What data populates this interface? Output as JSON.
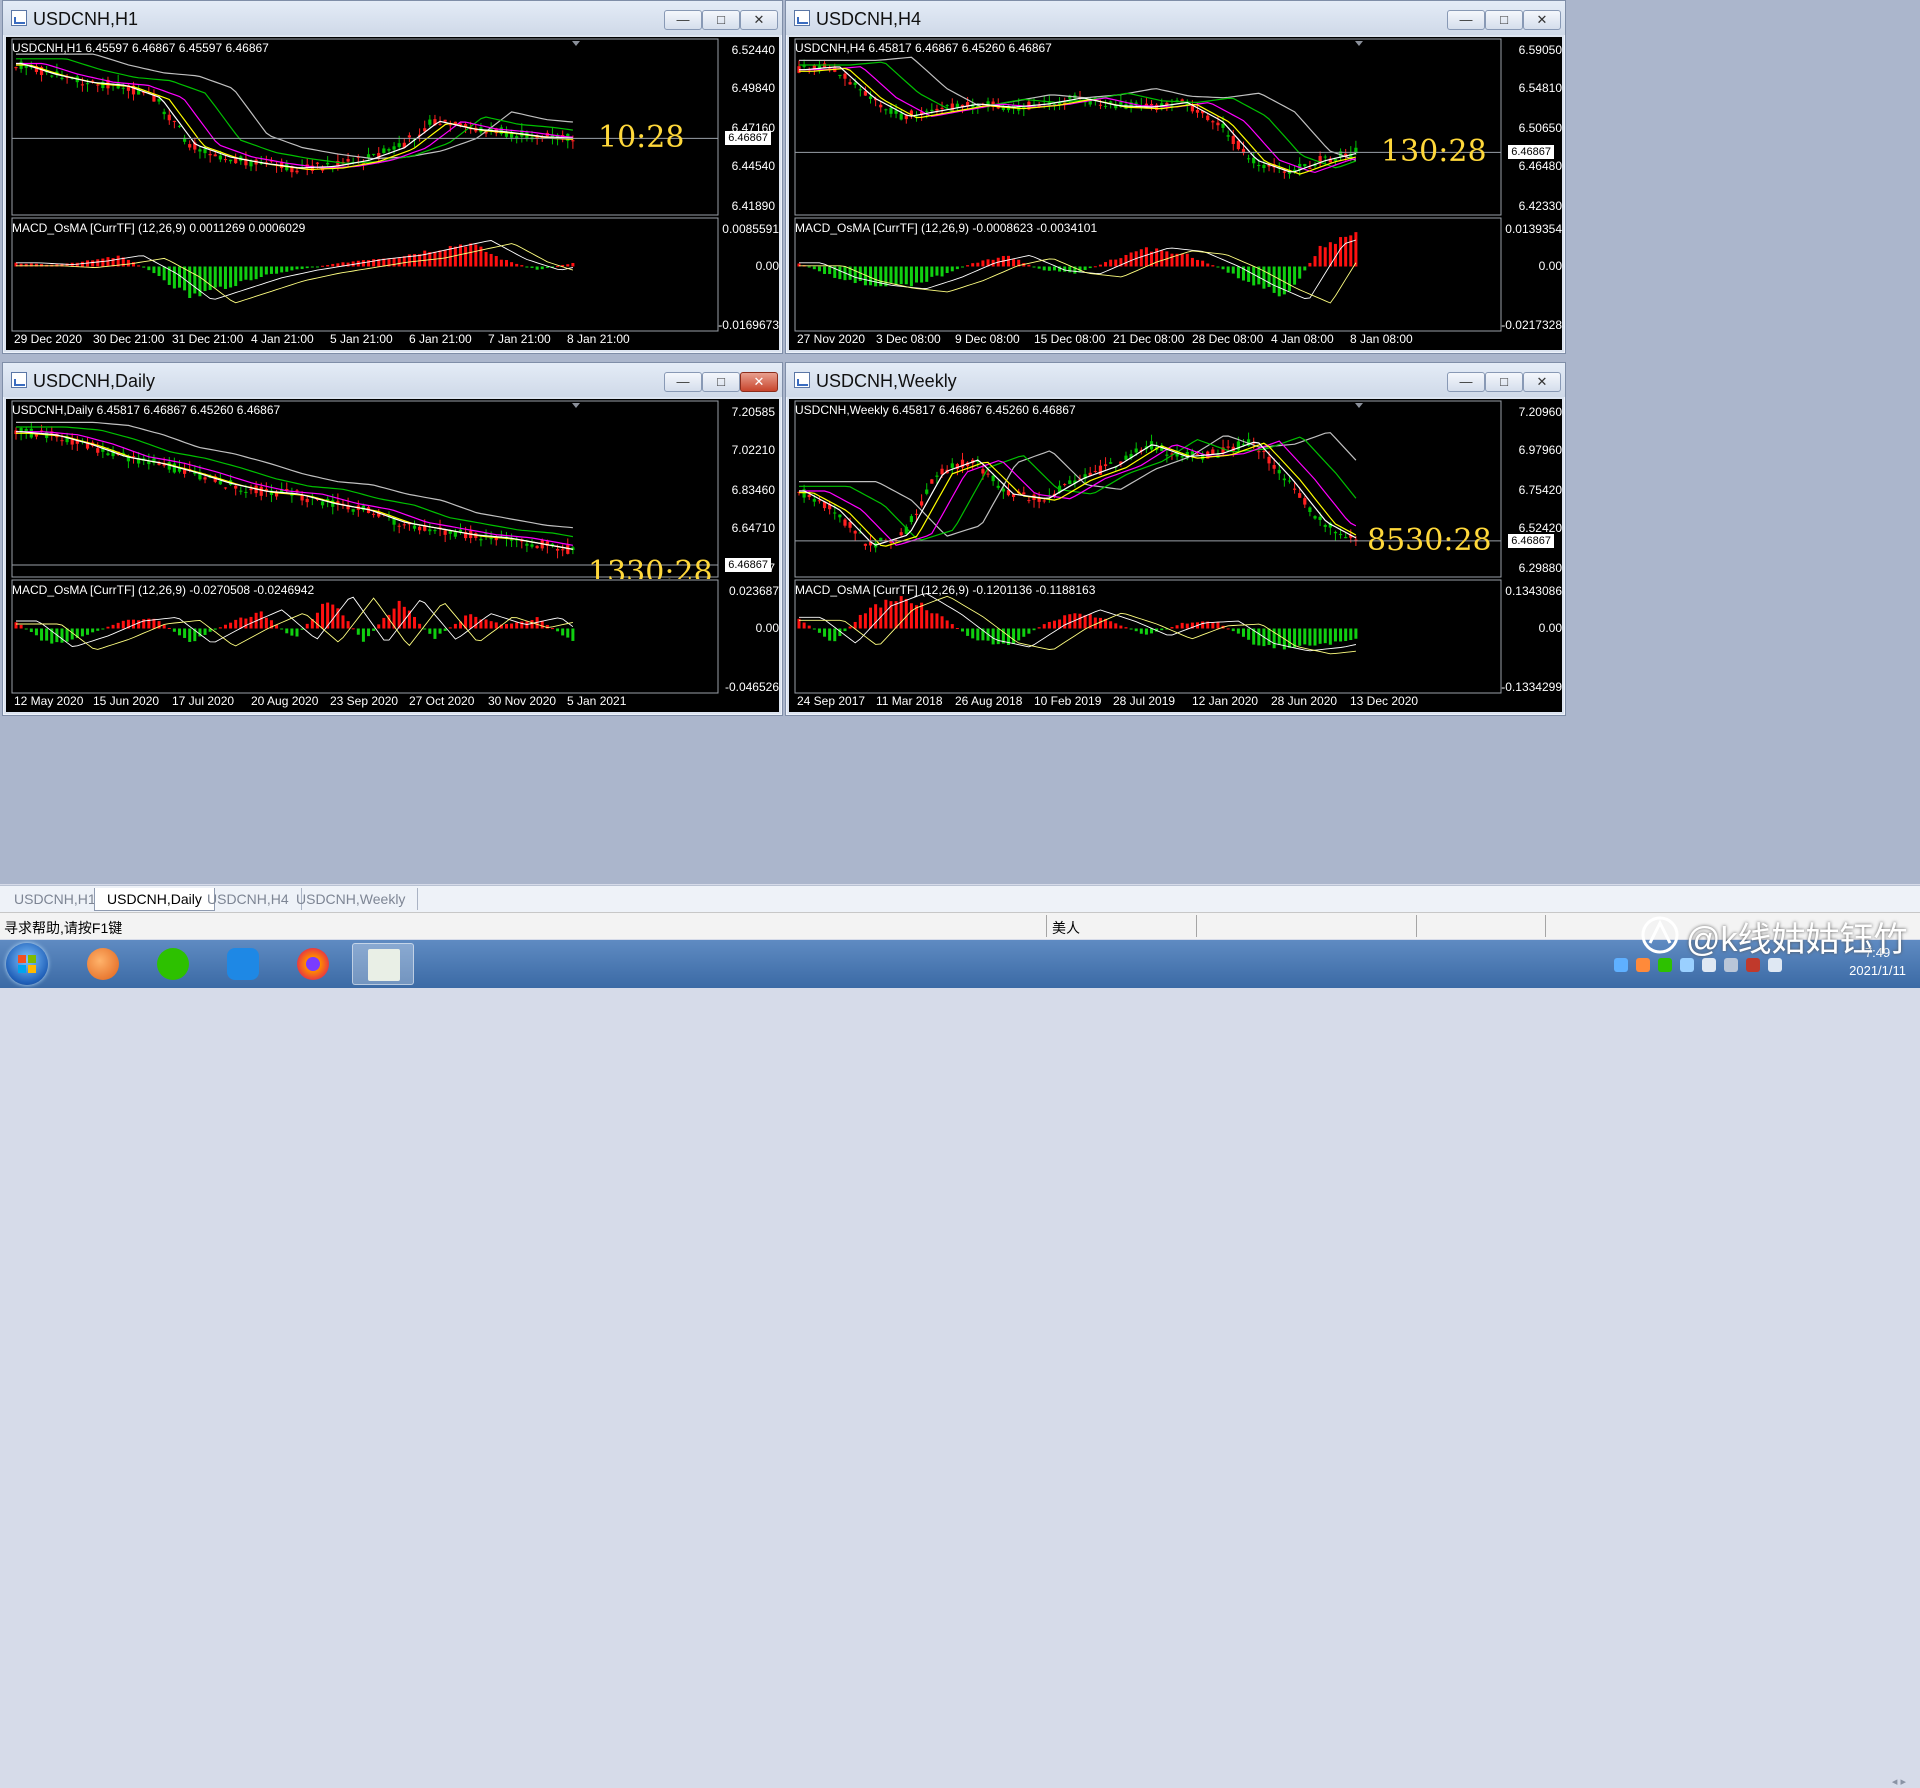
{
  "windows": [
    {
      "title": "USDCNH,H1",
      "header": "USDCNH,H1  6.45597 6.46867 6.45597 6.46867",
      "macd_header": "MACD_OsMA [CurrTF] (12,26,9) 0.0011269 0.0006029",
      "price_axis": [
        "6.52440",
        "6.49840",
        "6.47160",
        "6.44540",
        "6.41890"
      ],
      "current_price": "6.46867",
      "macd_axis": [
        "0.0085591",
        "0.00",
        "-0.0169673"
      ],
      "x_labels": [
        "29 Dec 2020",
        "30 Dec 21:00",
        "31 Dec 21:00",
        "4 Jan 21:00",
        "5 Jan 21:00",
        "6 Jan 21:00",
        "7 Jan 21:00",
        "8 Jan 21:00"
      ],
      "timer": "10:28"
    },
    {
      "title": "USDCNH,H4",
      "header": "USDCNH,H4  6.45817 6.46867 6.45260 6.46867",
      "macd_header": "MACD_OsMA [CurrTF] (12,26,9) -0.0008623 -0.0034101",
      "price_axis": [
        "6.59050",
        "6.54810",
        "6.50650",
        "6.46480",
        "6.42330"
      ],
      "current_price": "6.46867",
      "macd_axis": [
        "0.0139354",
        "0.00",
        "-0.0217328"
      ],
      "x_labels": [
        "27 Nov 2020",
        "3 Dec 08:00",
        "9 Dec 08:00",
        "15 Dec 08:00",
        "21 Dec 08:00",
        "28 Dec 08:00",
        "4 Jan 08:00",
        "8 Jan 08:00"
      ],
      "timer": "130:28"
    },
    {
      "title": "USDCNH,Daily",
      "header": "USDCNH,Daily  6.45817 6.46867 6.45260 6.46867",
      "macd_header": "MACD_OsMA [CurrTF] (12,26,9) -0.0270508 -0.0246942",
      "price_axis": [
        "7.20585",
        "7.02210",
        "6.83460",
        "6.64710",
        "6.46867"
      ],
      "current_price": "6.46867",
      "macd_axis": [
        "0.023687",
        "0.00",
        "-0.046526"
      ],
      "x_labels": [
        "12 May 2020",
        "15 Jun 2020",
        "17 Jul 2020",
        "20 Aug 2020",
        "23 Sep 2020",
        "27 Oct 2020",
        "30 Nov 2020",
        "5 Jan 2021"
      ],
      "timer": "1330:28"
    },
    {
      "title": "USDCNH,Weekly",
      "header": "USDCNH,Weekly  6.45817 6.46867 6.45260 6.46867",
      "macd_header": "MACD_OsMA [CurrTF] (12,26,9) -0.1201136 -0.1188163",
      "price_axis": [
        "7.20960",
        "6.97960",
        "6.75420",
        "6.52420",
        "6.29880"
      ],
      "current_price": "6.46867",
      "macd_axis": [
        "0.1343086",
        "0.00",
        "-0.1334299"
      ],
      "x_labels": [
        "24 Sep 2017",
        "11 Mar 2018",
        "26 Aug 2018",
        "10 Feb 2019",
        "28 Jul 2019",
        "12 Jan 2020",
        "28 Jun 2020",
        "13 Dec 2020"
      ],
      "timer": "8530:28"
    }
  ],
  "window_buttons": {
    "minimize": "—",
    "maximize": "□",
    "close": "✕"
  },
  "tabs": [
    "USDCNH,H1",
    "USDCNH,Daily",
    "USDCNH,H4",
    "USDCNH,Weekly"
  ],
  "active_tab": "USDCNH,Daily",
  "status": {
    "help": "寻求帮助,请按F1键",
    "profile": "美人"
  },
  "watermark": "@k线姑姑钰竹",
  "clock": {
    "time": "7:49",
    "date": "2021/1/11"
  },
  "taskbar_icons": [
    "start-orb",
    "foxmail-icon",
    "wechat-icon",
    "pen-icon",
    "firefox-icon",
    "metatrader-icon"
  ],
  "colors": {
    "bull_candle": "#00c000",
    "bear_candle": "#ff2020",
    "ma_fast": "#ffffff",
    "ma_yellow": "#ffff00",
    "ma_magenta": "#ff00ff",
    "ma_green": "#00c000",
    "ma_gray": "#c0c0c0",
    "timer": "#ffd83a",
    "macd_pos": "#ff1010",
    "macd_neg": "#10d010"
  }
}
